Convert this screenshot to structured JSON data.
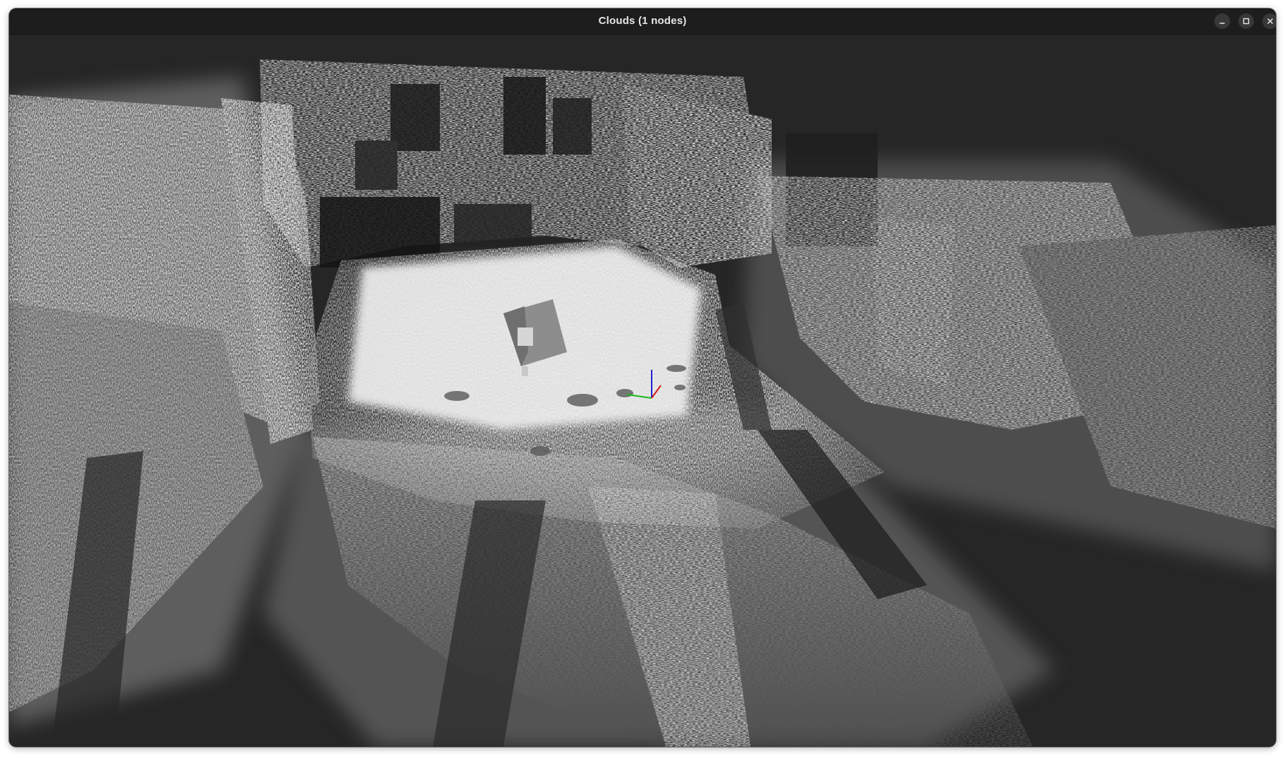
{
  "window": {
    "title": "Clouds (1 nodes)"
  },
  "titlebar_buttons": {
    "minimize": "minimize-icon",
    "maximize": "maximize-icon",
    "close": "close-icon"
  },
  "viewport": {
    "content": "point-cloud",
    "background_color": "#262626",
    "point_color": "#e0e0e0",
    "axis_colors": {
      "x": "#d01818",
      "y": "#18b818",
      "z": "#2020d0"
    }
  }
}
